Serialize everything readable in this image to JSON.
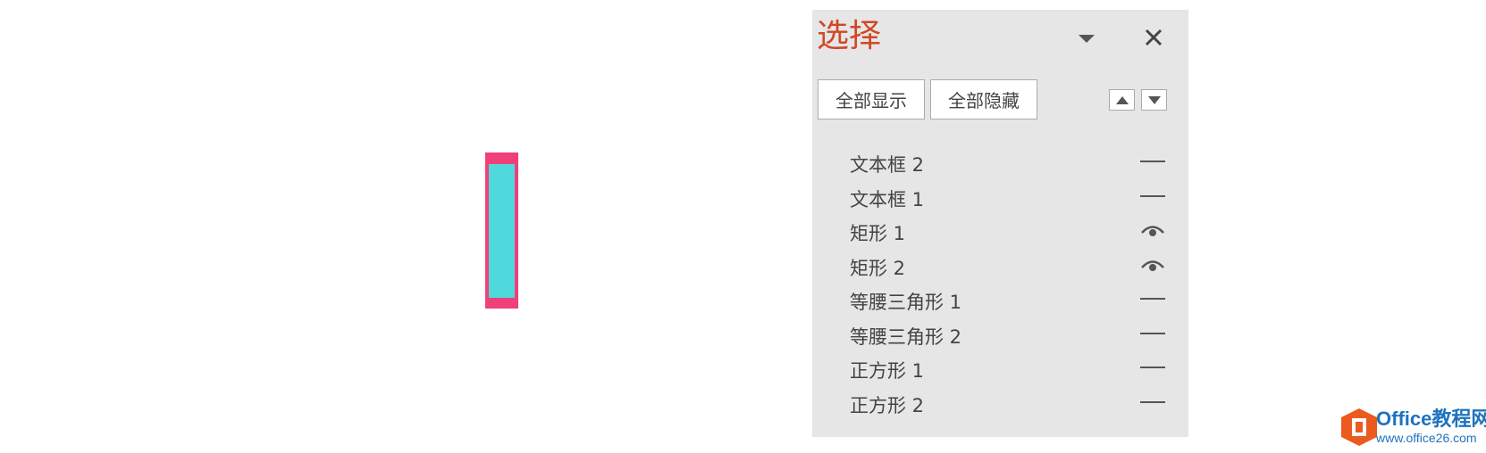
{
  "pane": {
    "title": "选择",
    "show_all_label": "全部显示",
    "hide_all_label": "全部隐藏"
  },
  "items": [
    {
      "label": "文本框 2",
      "visibility": "hidden"
    },
    {
      "label": "文本框 1",
      "visibility": "hidden"
    },
    {
      "label": "矩形 1",
      "visibility": "visible"
    },
    {
      "label": "矩形 2",
      "visibility": "visible"
    },
    {
      "label": "等腰三角形 1",
      "visibility": "hidden"
    },
    {
      "label": "等腰三角形 2",
      "visibility": "hidden"
    },
    {
      "label": "正方形 1",
      "visibility": "hidden"
    },
    {
      "label": "正方形 2",
      "visibility": "hidden"
    }
  ],
  "icons": {
    "dropdown": "chevron-down-icon",
    "close": "close-icon",
    "move_up": "arrow-up-icon",
    "move_down": "arrow-down-icon",
    "visible": "eye-icon",
    "hidden": "dash-icon"
  },
  "colors": {
    "title": "#d24726",
    "shape_border": "#f0407a",
    "shape_fill": "#4fd9dc",
    "pane_bg": "#e6e6e6",
    "logo": "#1e73be"
  },
  "watermark": {
    "name": "Office教程网",
    "url": "www.office26.com"
  }
}
